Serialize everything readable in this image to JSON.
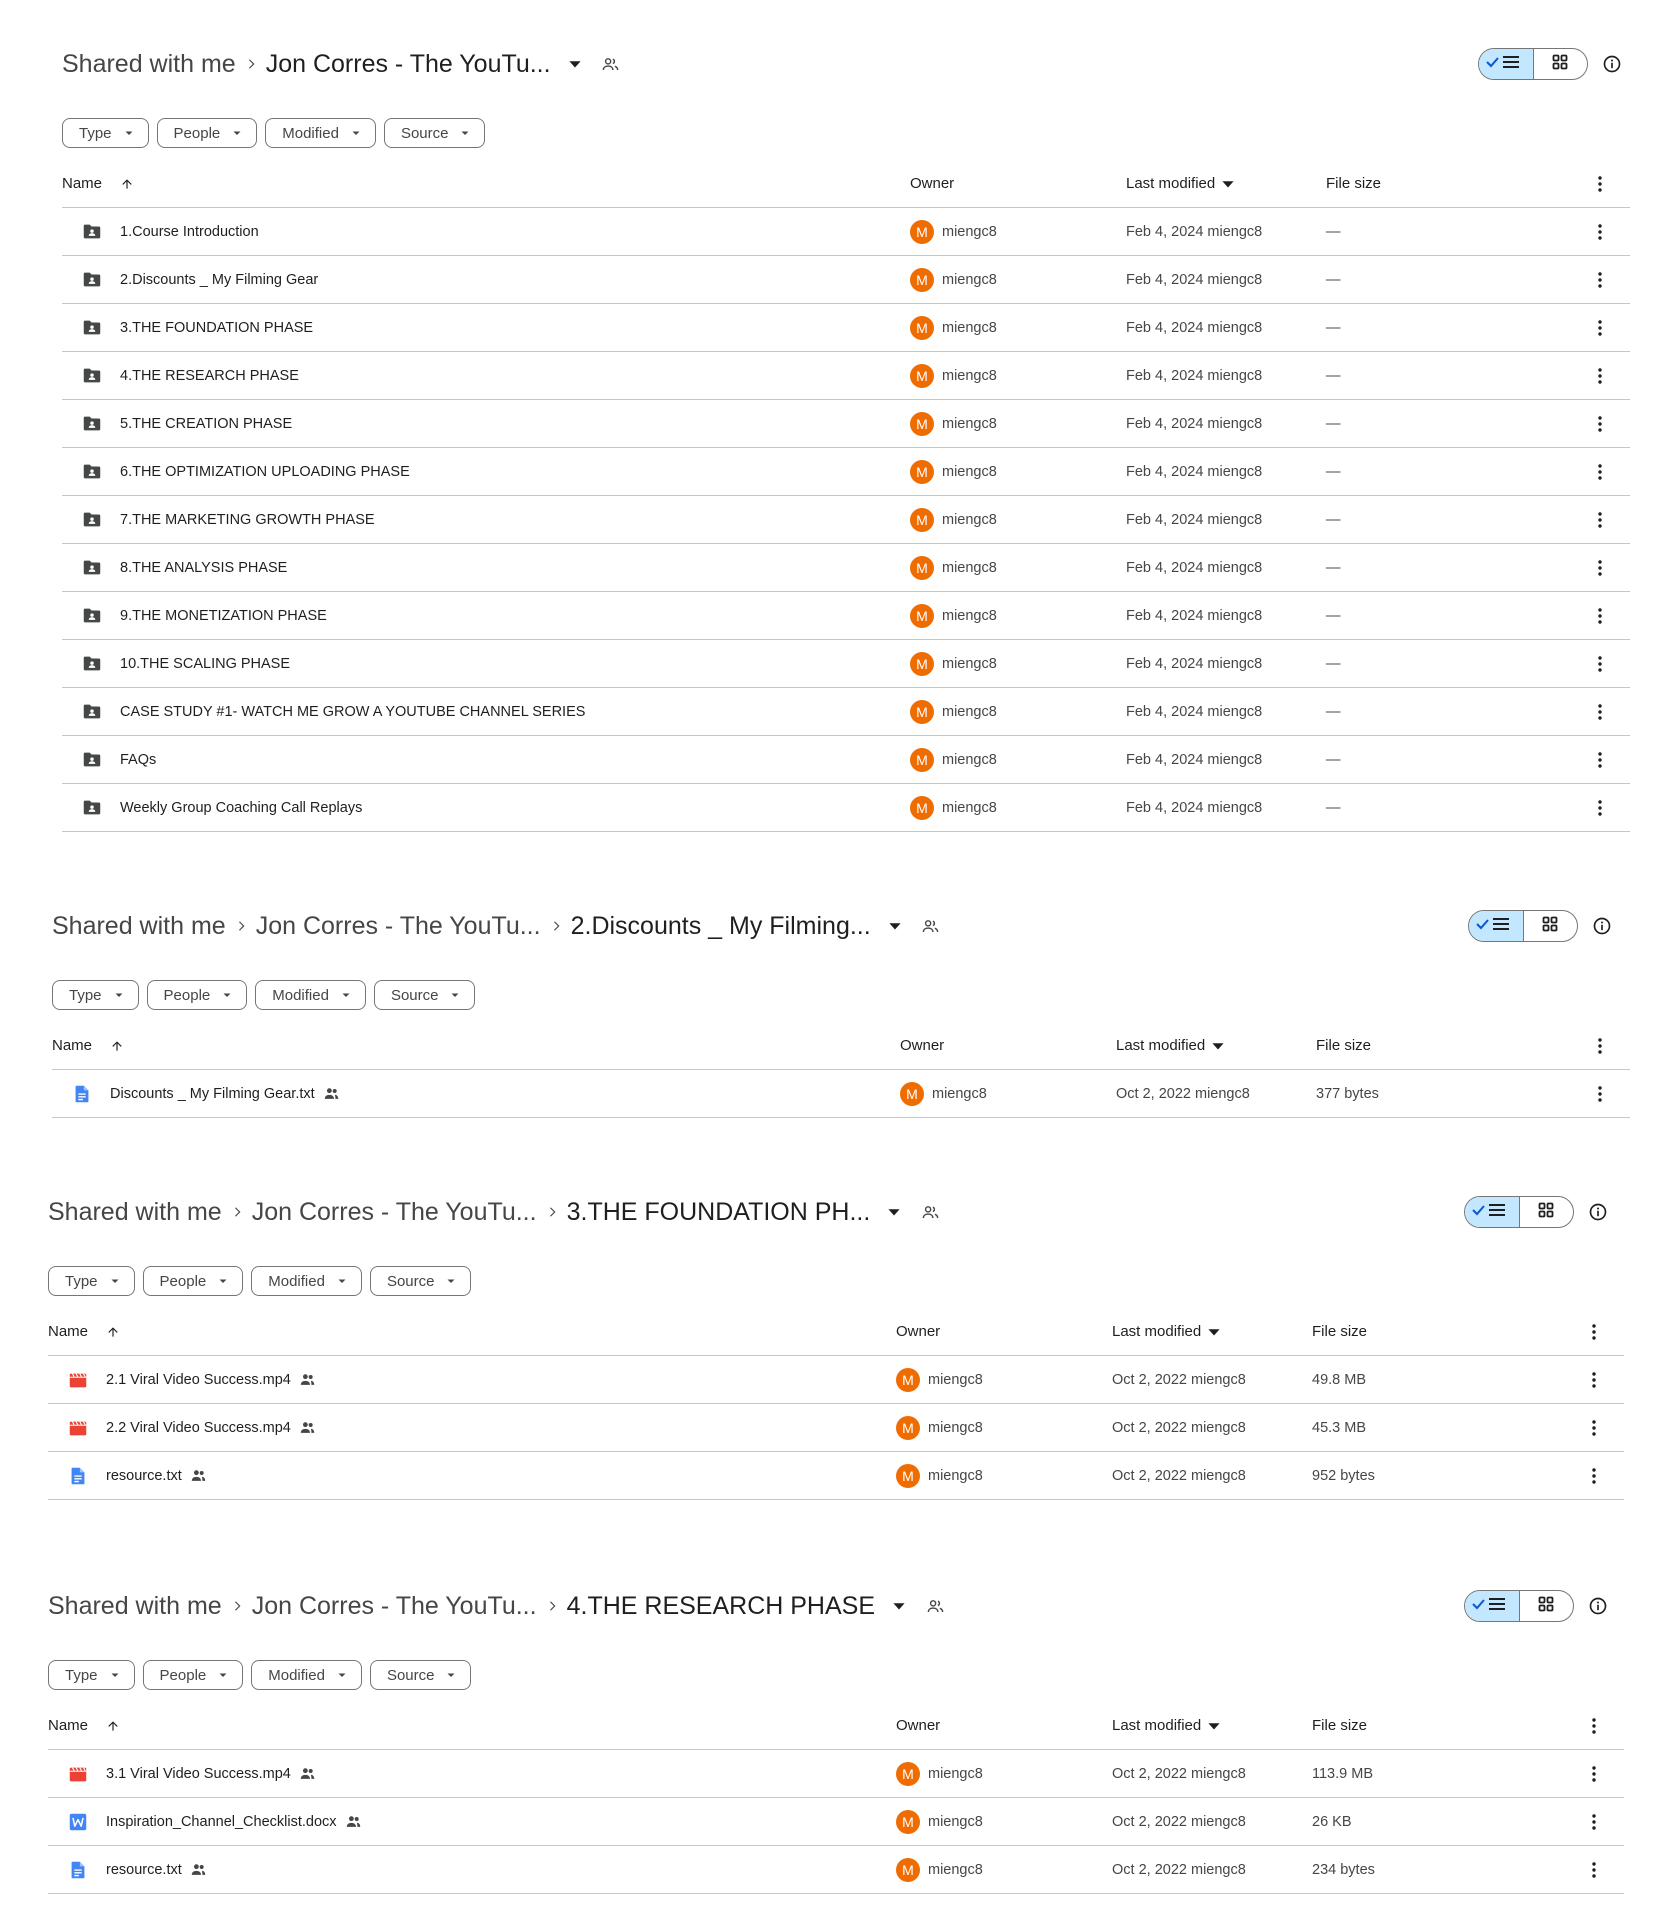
{
  "common": {
    "shared_with_me": "Shared with me",
    "course": "Jon Corres - The YouTu...",
    "filters": [
      "Type",
      "People",
      "Modified",
      "Source"
    ],
    "columns": {
      "name": "Name",
      "owner": "Owner",
      "modified": "Last modified",
      "size": "File size"
    },
    "owner": "miengc8",
    "avatar_letter": "M"
  },
  "colors": {
    "avatar": "#ef6c00",
    "toggle_active": "#c2e7ff",
    "video_icon": "#ea4335",
    "doc_icon": "#4285f4",
    "folder_icon": "#444746"
  },
  "panels": [
    {
      "crumbs": [
        "Shared with me",
        "Jon Corres - The YouTu..."
      ],
      "rows": [
        {
          "icon": "shared-folder-icon",
          "name": "1.Course Introduction",
          "modified": "Feb 4, 2024 miengc8",
          "size": "—"
        },
        {
          "icon": "shared-folder-icon",
          "name": "2.Discounts _ My Filming Gear",
          "modified": "Feb 4, 2024 miengc8",
          "size": "—"
        },
        {
          "icon": "shared-folder-icon",
          "name": "3.THE FOUNDATION PHASE",
          "modified": "Feb 4, 2024 miengc8",
          "size": "—"
        },
        {
          "icon": "shared-folder-icon",
          "name": "4.THE RESEARCH PHASE",
          "modified": "Feb 4, 2024 miengc8",
          "size": "—"
        },
        {
          "icon": "shared-folder-icon",
          "name": "5.THE CREATION PHASE",
          "modified": "Feb 4, 2024 miengc8",
          "size": "—"
        },
        {
          "icon": "shared-folder-icon",
          "name": "6.THE OPTIMIZATION UPLOADING PHASE",
          "modified": "Feb 4, 2024 miengc8",
          "size": "—"
        },
        {
          "icon": "shared-folder-icon",
          "name": "7.THE MARKETING GROWTH PHASE",
          "modified": "Feb 4, 2024 miengc8",
          "size": "—"
        },
        {
          "icon": "shared-folder-icon",
          "name": "8.THE ANALYSIS PHASE",
          "modified": "Feb 4, 2024 miengc8",
          "size": "—"
        },
        {
          "icon": "shared-folder-icon",
          "name": "9.THE MONETIZATION PHASE",
          "modified": "Feb 4, 2024 miengc8",
          "size": "—"
        },
        {
          "icon": "shared-folder-icon",
          "name": "10.THE SCALING PHASE",
          "modified": "Feb 4, 2024 miengc8",
          "size": "—"
        },
        {
          "icon": "shared-folder-icon",
          "name": "CASE STUDY #1- WATCH ME GROW A YOUTUBE CHANNEL SERIES",
          "modified": "Feb 4, 2024 miengc8",
          "size": "—"
        },
        {
          "icon": "shared-folder-icon",
          "name": "FAQs",
          "modified": "Feb 4, 2024 miengc8",
          "size": "—"
        },
        {
          "icon": "shared-folder-icon",
          "name": "Weekly Group Coaching Call Replays",
          "modified": "Feb 4, 2024 miengc8",
          "size": "—"
        }
      ]
    },
    {
      "crumbs": [
        "Shared with me",
        "Jon Corres - The YouTu...",
        "2.Discounts _ My Filming..."
      ],
      "rows": [
        {
          "icon": "text-file-icon",
          "name": "Discounts _ My Filming Gear.txt",
          "shared": true,
          "modified": "Oct 2, 2022 miengc8",
          "size": "377 bytes"
        }
      ]
    },
    {
      "crumbs": [
        "Shared with me",
        "Jon Corres - The YouTu...",
        "3.THE FOUNDATION PH..."
      ],
      "rows": [
        {
          "icon": "video-file-icon",
          "name": "2.1 Viral Video Success.mp4",
          "shared": true,
          "modified": "Oct 2, 2022 miengc8",
          "size": "49.8 MB"
        },
        {
          "icon": "video-file-icon",
          "name": "2.2 Viral Video Success.mp4",
          "shared": true,
          "modified": "Oct 2, 2022 miengc8",
          "size": "45.3 MB"
        },
        {
          "icon": "text-file-icon",
          "name": "resource.txt",
          "shared": true,
          "modified": "Oct 2, 2022 miengc8",
          "size": "952 bytes"
        }
      ]
    },
    {
      "crumbs": [
        "Shared with me",
        "Jon Corres - The YouTu...",
        "4.THE RESEARCH PHASE"
      ],
      "rows": [
        {
          "icon": "video-file-icon",
          "name": "3.1 Viral Video Success.mp4",
          "shared": true,
          "modified": "Oct 2, 2022 miengc8",
          "size": "113.9 MB"
        },
        {
          "icon": "word-doc-icon",
          "name": "Inspiration_Channel_Checklist.docx",
          "shared": true,
          "modified": "Oct 2, 2022 miengc8",
          "size": "26 KB"
        },
        {
          "icon": "text-file-icon",
          "name": "resource.txt",
          "shared": true,
          "modified": "Oct 2, 2022 miengc8",
          "size": "234 bytes"
        }
      ]
    }
  ]
}
